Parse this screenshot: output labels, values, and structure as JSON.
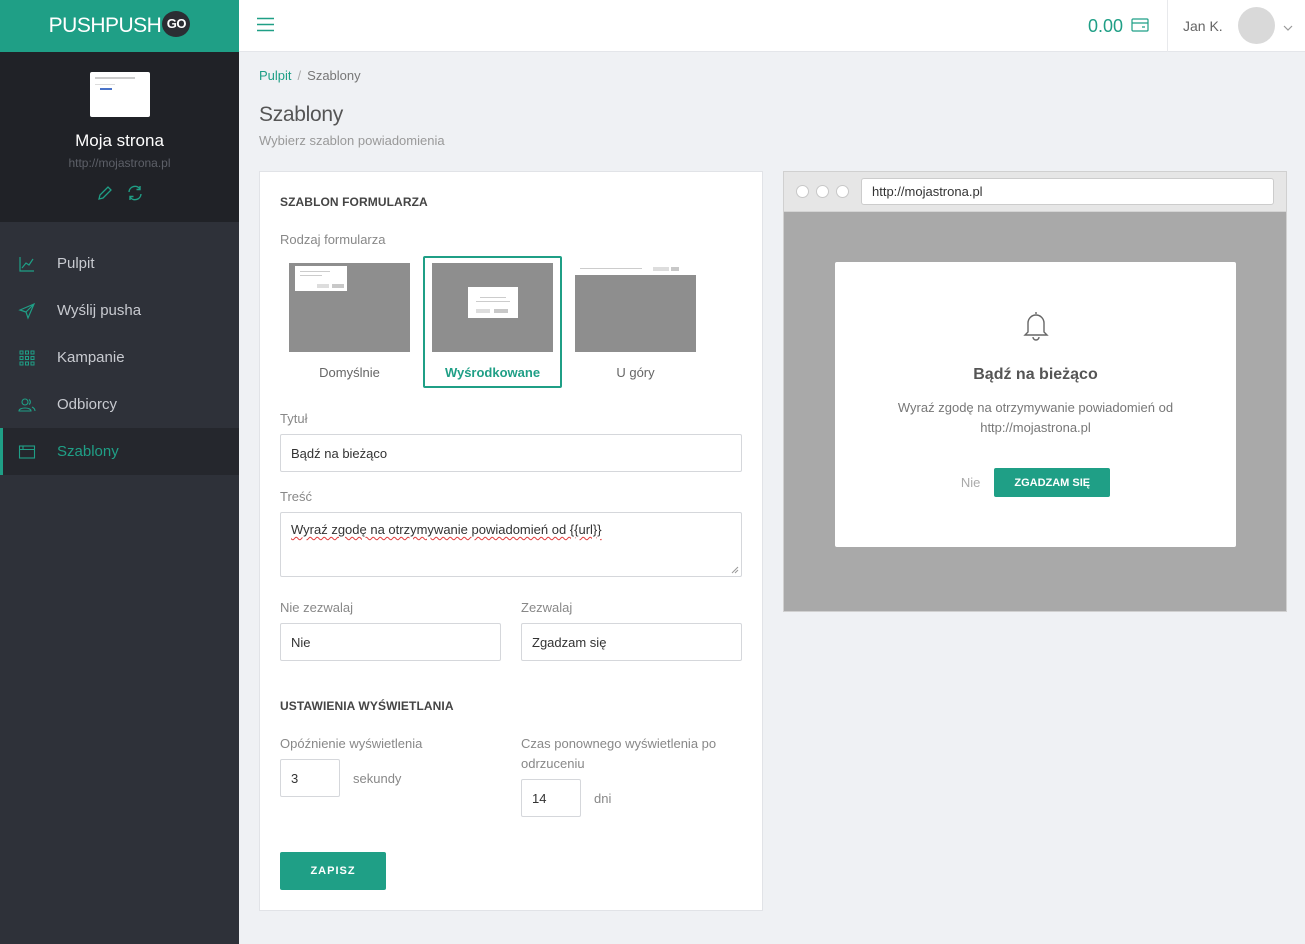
{
  "app": {
    "logo_text": "PUSHPUSH",
    "logo_badge": "GO"
  },
  "site": {
    "name": "Moja strona",
    "url": "http://mojastrona.pl"
  },
  "nav": {
    "items": [
      {
        "label": "Pulpit",
        "icon": "chart-line-icon"
      },
      {
        "label": "Wyślij pusha",
        "icon": "send-icon"
      },
      {
        "label": "Kampanie",
        "icon": "grid-icon"
      },
      {
        "label": "Odbiorcy",
        "icon": "users-icon"
      },
      {
        "label": "Szablony",
        "icon": "window-icon",
        "active": true
      }
    ]
  },
  "topbar": {
    "balance": "0.00",
    "user_name": "Jan K."
  },
  "breadcrumb": {
    "home": "Pulpit",
    "current": "Szablony"
  },
  "page": {
    "title": "Szablony",
    "subtitle": "Wybierz szablon powiadomienia"
  },
  "form": {
    "section_title": "SZABLON FORMULARZA",
    "type_label": "Rodzaj formularza",
    "templates": [
      {
        "label": "Domyślnie",
        "selected": false
      },
      {
        "label": "Wyśrodkowane",
        "selected": true
      },
      {
        "label": "U góry",
        "selected": false
      }
    ],
    "title_label": "Tytuł",
    "title_value": "Bądź na bieżąco",
    "body_label": "Treść",
    "body_value": "Wyraź zgodę na otrzymywanie powiadomień od {{url}}",
    "deny_label": "Nie zezwalaj",
    "deny_value": "Nie",
    "allow_label": "Zezwalaj",
    "allow_value": "Zgadzam się"
  },
  "display": {
    "section_title": "USTAWIENIA WYŚWIETLANIA",
    "delay_label": "Opóźnienie wyświetlenia",
    "delay_value": "3",
    "delay_unit": "sekundy",
    "redisplay_label": "Czas ponownego wyświetlenia po odrzuceniu",
    "redisplay_value": "14",
    "redisplay_unit": "dni"
  },
  "save_label": "ZAPISZ",
  "preview": {
    "url": "http://mojastrona.pl",
    "title": "Bądź na bieżąco",
    "body": "Wyraź zgodę na otrzymywanie powiadomień od http://mojastrona.pl",
    "deny": "Nie",
    "allow": "ZGADZAM SIĘ"
  },
  "colors": {
    "accent": "#1f9f86",
    "sidebar": "#2e3139",
    "sidebar_dark": "#202227"
  }
}
